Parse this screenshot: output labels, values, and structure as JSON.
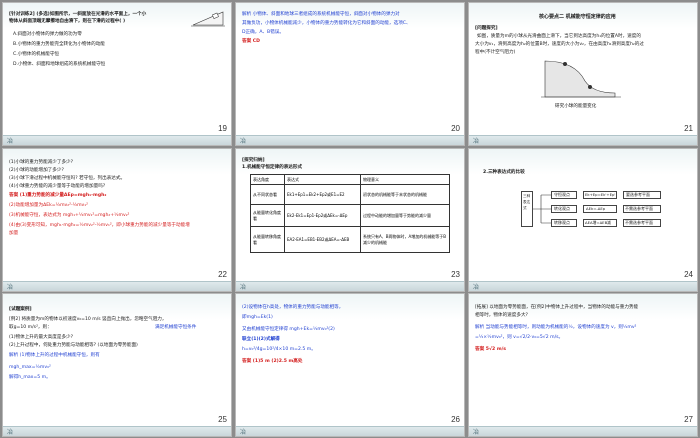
{
  "slides": [
    {
      "num": "19"
    },
    {
      "num": "20"
    },
    {
      "num": "21"
    },
    {
      "num": "22"
    },
    {
      "num": "23"
    },
    {
      "num": "24"
    },
    {
      "num": "25"
    },
    {
      "num": "26"
    },
    {
      "num": "27"
    }
  ],
  "s19": {
    "q": "[针对训练2] (多选)如图所示，一斜面放在光滑的水平面上，一个小",
    "q2": "物体从斜面顶端无摩擦地自由滑下，则在下滑的过程中(     )",
    "a": "A.斜面对小物体的弹力做的功为零",
    "b": "B.小物体的重力势能完全转化为小物体的动能",
    "c": "C.小物体的机械能守恒",
    "d": "D.小物体、斜面和地球组成的系统机械能守恒"
  },
  "s20": {
    "l1": "解析  小物体、斜面和地球三者组成的系统机械能守恒，斜面对小物体的弹力对",
    "l2": "其做负功，小物体机械能减少，小物体的重力势能转化为它和斜面的动能，选项C、",
    "l3": "D正确，A、B错误。",
    "ans": "答案  CD"
  },
  "s21": {
    "title": "核心要点二  机械能守恒定律的应用",
    "tag": "[问题探究]",
    "l1": "如图，质量为m的小球从光滑曲面上滑下，当它到达高度为h₁的位置A时，速度的",
    "l2": "大小为v₁，滑到高度为h₂的位置B时，速度的大小为v₂，在由高度h₁滑到高度h₂的过",
    "l3": "程中(不计空气阻力)",
    "caption": "研究小球的能量变化"
  },
  "s22": {
    "l1": "(1)小球的重力势能减少了多少?",
    "l2": "(2)小球的动能增加了多少?",
    "l3": "(3)小球下滑过程中机械能守恒吗? 若守恒，列出表达式。",
    "l4": "(4)小球重力势能的减少量等于动能的增加量吗?",
    "ans": "答案  (1)重力势能的减少量ΔEp=mgh₁-mgh₂",
    "a2": "(2)动能增加量为ΔEk=½mv₂²-½mv₁²",
    "a3": "(3)机械能守恒，表达式为 mgh₁+½mv₁²=mgh₂+½mv₂²",
    "a4": "(4)由(3)变形可知，mgh₁-mgh₂=½mv₂²-½mv₁²，即小球重力势能的减少量等于动能增",
    "a5": "加量"
  },
  "s23": {
    "tag": "[探究归纳]",
    "title": "1.机械能守恒定律的表达形式",
    "h": [
      "表达角度",
      "表达式",
      "物理意义"
    ],
    "rows": [
      [
        "从不同状态看",
        "Ek1+Ep1=Ek2+Ep2或E1=E2",
        "初状态的机械能等于末状态的机械能"
      ],
      [
        "从能量转化角度看",
        "Ek2-Ek1=Ep1-Ep2或ΔEk=-ΔEp",
        "过程中动能的增加量等于势能的减少量"
      ],
      [
        "从能量转移角度看",
        "EA2-EA1=EB1-EB2或ΔEA=-ΔEB",
        "系统只有A、B两物体时，A增加的机械能等于B减少的机械能"
      ]
    ]
  },
  "s24": {
    "title": "2.三种表达式的比较",
    "root": "三种表达式",
    "n1": "守恒观点",
    "n1b": "Ek+Ep=Ek'+Ep'",
    "n1c": "要选参考平面",
    "n2": "转化观点",
    "n2b": "ΔEk=-ΔEp",
    "n2c": "不需选参考平面",
    "n3": "转移观点",
    "n3b": "ΔEA增=ΔEB减",
    "n3c": "不需选参考平面"
  },
  "s25": {
    "tag": "[试题案例]",
    "l1": "[例2] 将质量为m的物体以初速度v₀=10 m/s 竖直向上抛出，忽略空气阻力，",
    "l2": "取g=10 m/s²，则：",
    "note": "满足机械能守恒条件",
    "l3": "(1)物体上升的最大高度是多少?",
    "l4": "(2)上升过程中，何处重力势能与动能相等? (以地面为零势能面)",
    "l5": "解析  (1)物体上升的过程中机械能守恒，则有",
    "l6": "mgh_max=½mv₀²",
    "l7": "解得h_max=5 m。"
  },
  "s26": {
    "l1": "(2)设物体在h高处，物体的重力势能与动能相等，",
    "l2": "即mgh=Ek(1)",
    "l3": "又由机械能守恒定律得 mgh+Ek=½mv₀²(2)",
    "l4": "联立(1)(2)式解得",
    "l5": "h=v₀²/4g=10²/4×10 m=2.5 m。",
    "ans": "答案  (1)5 m  (2)2.5 m高处"
  },
  "s27": {
    "l1": "[拓展] 以地面为零势能面，在[例2]中物体上升过程中，当物体的动能与重力势能",
    "l2": "相等时，物体的速度多大?",
    "l3": "解析  当动能与势能相等时，则动能为机械能的½，设物体的速度为 v，则½mv²",
    "l4": "=½×½mv₀²，则 v=√2/2·v₀=5√2 m/s。",
    "ans": "答案  5√2 m/s"
  },
  "footer": "冶"
}
